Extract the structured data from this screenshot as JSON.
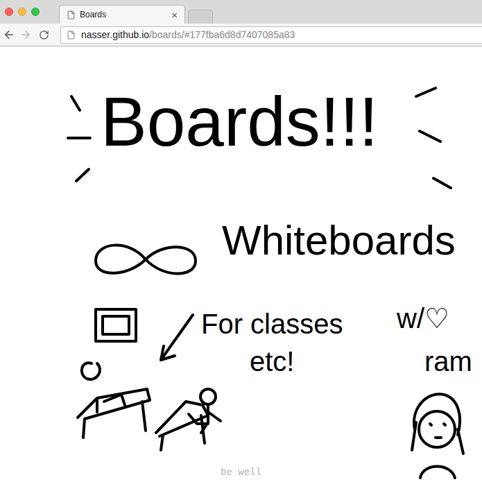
{
  "browser": {
    "tabs": [
      {
        "label": "Boards",
        "close": "×",
        "selected": true
      },
      {
        "label": "",
        "close": "",
        "selected": false
      }
    ],
    "back_enabled": true,
    "forward_enabled": false,
    "address": {
      "host": "nasser.github.io",
      "path": "/boards/#177fba6d8d7407085a83"
    }
  },
  "board": {
    "title": "Boards!!!",
    "subtitle": "Whiteboards",
    "note_lines": [
      "For classes",
      "etc!"
    ],
    "aside_lines": [
      "w/♡",
      "ram"
    ],
    "footer": "be well"
  }
}
